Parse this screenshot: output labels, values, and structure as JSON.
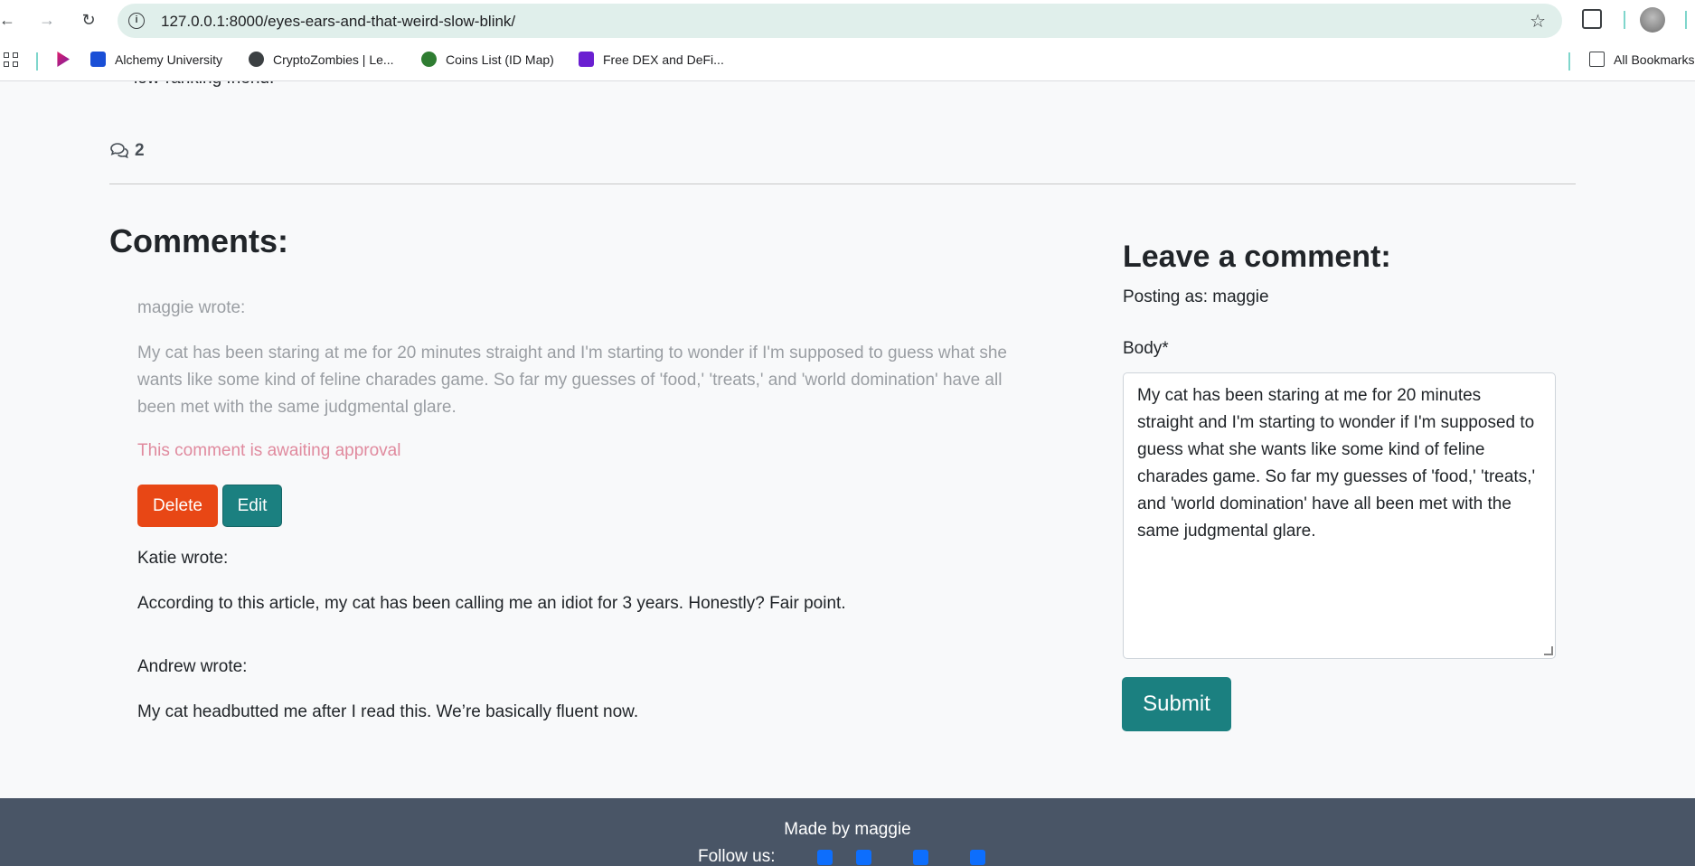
{
  "browser": {
    "url": "127.0.0.1:8000/eyes-ears-and-that-weird-slow-blink/",
    "bookmarks": [
      {
        "label": "Alchemy University",
        "color": "#1a4fd6"
      },
      {
        "label": "CryptoZombies | Le...",
        "color": "#3c4043"
      },
      {
        "label": "Coins List (ID Map)",
        "color": "#2f7d32"
      },
      {
        "label": "Free DEX and DeFi...",
        "color": "#6a1fd1"
      }
    ],
    "all_bookmarks": "All Bookmarks"
  },
  "post": {
    "cut_text": "low-ranking friend.",
    "comment_count": "2"
  },
  "comments": {
    "title": "Comments:",
    "items": [
      {
        "author": "maggie wrote:",
        "body": "My cat has been staring at me for 20 minutes straight and I'm starting to wonder if I'm supposed to guess what she wants like some kind of feline charades game. So far my guesses of 'food,' 'treats,' and 'world domination' have all been met with the same judgmental glare.",
        "status": "This comment is awaiting approval",
        "delete_label": "Delete",
        "edit_label": "Edit"
      },
      {
        "author": "Katie wrote:",
        "body": "According to this article, my cat has been calling me an idiot for 3 years. Honestly? Fair point."
      },
      {
        "author": "Andrew wrote:",
        "body": "My cat headbutted me after I read this. We’re basically fluent now."
      }
    ]
  },
  "form": {
    "title": "Leave a comment:",
    "posting_as": "Posting as: maggie",
    "body_label": "Body*",
    "body_value": "My cat has been staring at me for 20 minutes straight and I'm starting to wonder if I'm supposed to guess what she wants like some kind of feline charades game. So far my guesses of 'food,' 'treats,' and 'world domination' have all been met with the same judgmental glare.",
    "submit_label": "Submit"
  },
  "footer": {
    "made_by": "Made by maggie",
    "follow": "Follow us:"
  },
  "colors": {
    "primary": "#1b8080",
    "danger": "#e84715",
    "footer": "#495566"
  }
}
